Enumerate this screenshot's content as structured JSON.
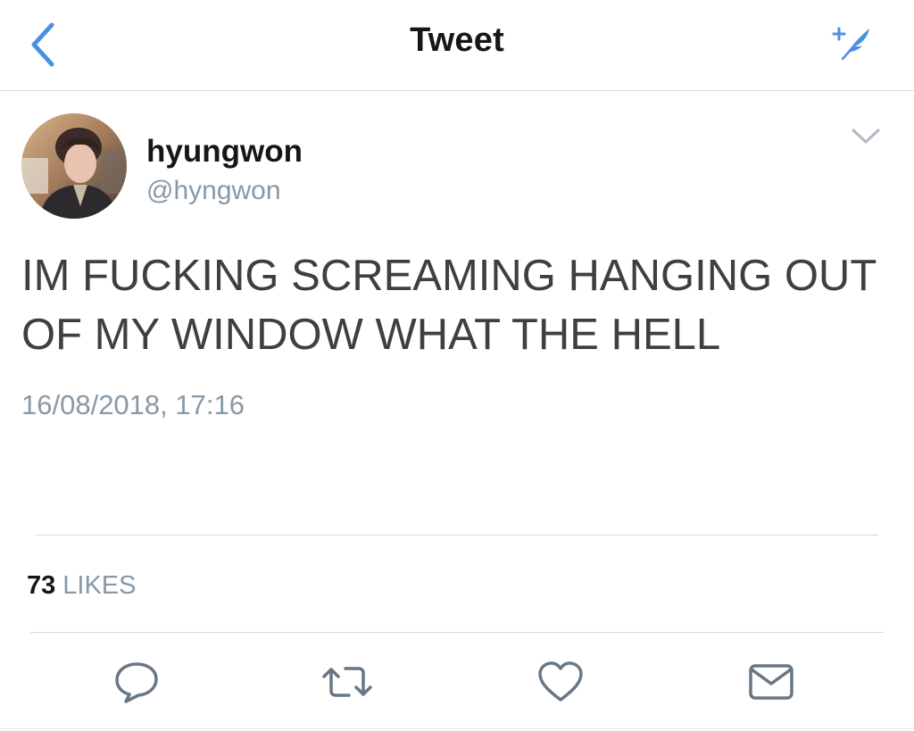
{
  "header": {
    "title": "Tweet",
    "back_icon": "chevron-left-icon",
    "compose_icon": "compose-feather-icon",
    "accent_color": "#4a90e2"
  },
  "tweet": {
    "author": {
      "display_name": "hyungwon",
      "handle": "@hyngwon",
      "avatar_icon": "profile-photo"
    },
    "text_line1": "IM FUCKING SCREAMING HANGING OUT",
    "text_line2": "OF MY WINDOW WHAT THE HELL",
    "timestamp": "16/08/2018, 17:16",
    "likes": {
      "count": "73",
      "label": "LIKES"
    }
  },
  "actions": [
    {
      "name": "reply",
      "icon": "reply-bubble-icon"
    },
    {
      "name": "retweet",
      "icon": "retweet-icon"
    },
    {
      "name": "like",
      "icon": "heart-icon"
    },
    {
      "name": "direct-message",
      "icon": "envelope-icon"
    }
  ],
  "colors": {
    "text_primary": "#14171a",
    "text_body": "#3c4043",
    "text_secondary": "#8899a6",
    "icon_gray": "#697785",
    "divider": "#d5d8dc"
  }
}
